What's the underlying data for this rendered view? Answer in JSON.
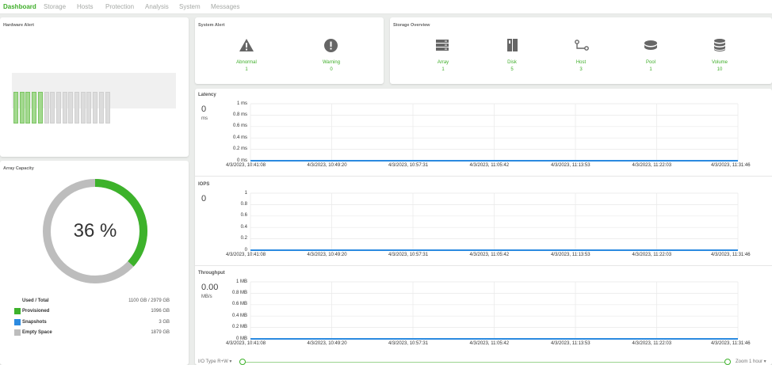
{
  "nav": {
    "items": [
      "Dashboard",
      "Storage",
      "Hosts",
      "Protection",
      "Analysis",
      "System",
      "Messages"
    ]
  },
  "hardware_alert": {
    "title": "Hardware Alert",
    "filled_slots": 5,
    "total_slots": 16
  },
  "system_alert": {
    "title": "System Alert",
    "items": [
      {
        "label": "Abnormal",
        "value": "1",
        "icon": "warning-triangle"
      },
      {
        "label": "Warning",
        "value": "0",
        "icon": "exclamation-circle"
      }
    ]
  },
  "storage_overview": {
    "title": "Storage Overview",
    "items": [
      {
        "label": "Array",
        "value": "1",
        "icon": "array"
      },
      {
        "label": "Disk",
        "value": "5",
        "icon": "disk"
      },
      {
        "label": "Host",
        "value": "3",
        "icon": "host"
      },
      {
        "label": "Pool",
        "value": "1",
        "icon": "pool"
      },
      {
        "label": "Volume",
        "value": "10",
        "icon": "volume"
      }
    ]
  },
  "array_capacity": {
    "title": "Array Capacity",
    "percent_text": "36 %",
    "used_fraction": 0.368,
    "header": {
      "label": "Used / Total",
      "value": "1100 GB / 2979 GB"
    },
    "legend": [
      {
        "label": "Provisioned",
        "value": "1096 GB",
        "color": "#3db22b"
      },
      {
        "label": "Snapshots",
        "value": "3 GB",
        "color": "#2b8ae0"
      },
      {
        "label": "Empty Space",
        "value": "1879 GB",
        "color": "#bdbdbd"
      }
    ]
  },
  "charts": {
    "latency": {
      "title": "Latency",
      "value": "0",
      "unit": "ms",
      "yticks": [
        "1 ms",
        "0.8 ms",
        "0.6 ms",
        "0.4 ms",
        "0.2 ms",
        "0 ms"
      ]
    },
    "iops": {
      "title": "IOPS",
      "value": "0",
      "unit": "",
      "yticks": [
        "1",
        "0.8",
        "0.6",
        "0.4",
        "0.2",
        "0"
      ]
    },
    "throughput": {
      "title": "Throughput",
      "value": "0.00",
      "unit": "MB/s",
      "yticks": [
        "1 MB",
        "0.8 MB",
        "0.6 MB",
        "0.4 MB",
        "0.2 MB",
        "0 MB"
      ]
    }
  },
  "chart_data": [
    {
      "type": "line",
      "title": "Latency",
      "ylim": [
        0,
        1
      ],
      "x": [
        "4/3/2023, 10:41:08",
        "4/3/2023, 10:49:20",
        "4/3/2023, 10:57:31",
        "4/3/2023, 11:05:42",
        "4/3/2023, 11:13:53",
        "4/3/2023, 11:22:03",
        "4/3/2023, 11:31:46"
      ],
      "values": [
        0,
        0,
        0,
        0,
        0,
        0,
        0
      ]
    },
    {
      "type": "line",
      "title": "IOPS",
      "ylim": [
        0,
        1
      ],
      "x": [
        "4/3/2023, 10:41:08",
        "4/3/2023, 10:49:20",
        "4/3/2023, 10:57:31",
        "4/3/2023, 11:05:42",
        "4/3/2023, 11:13:53",
        "4/3/2023, 11:22:03",
        "4/3/2023, 11:31:46"
      ],
      "values": [
        0,
        0,
        0,
        0,
        0,
        0,
        0
      ]
    },
    {
      "type": "line",
      "title": "Throughput",
      "ylim": [
        0,
        1
      ],
      "x": [
        "4/3/2023, 10:41:08",
        "4/3/2023, 10:49:20",
        "4/3/2023, 10:57:31",
        "4/3/2023, 11:05:42",
        "4/3/2023, 11:13:53",
        "4/3/2023, 11:22:03",
        "4/3/2023, 11:31:46"
      ],
      "values": [
        0,
        0,
        0,
        0,
        0,
        0,
        0
      ]
    }
  ],
  "footer": {
    "io_type": "I/O Type R+W ▾",
    "zoom": "Zoom 1 hour ▾"
  }
}
